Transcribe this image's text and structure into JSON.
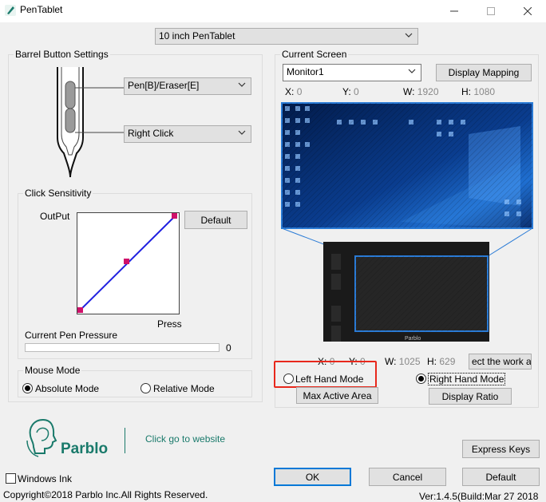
{
  "window": {
    "title": "PenTablet",
    "min_icon": "minimize-icon",
    "max_icon": "maximize-icon",
    "close_icon": "close-icon"
  },
  "device_select": {
    "value": "10 inch PenTablet"
  },
  "barrel": {
    "group_label": "Barrel Button Settings",
    "upper_button": "Pen[B]/Eraser[E]",
    "lower_button": "Right Click"
  },
  "sensitivity": {
    "group_label": "Click Sensitivity",
    "output_label": "OutPut",
    "press_label": "Press",
    "default_button": "Default",
    "pressure_label": "Current Pen Pressure",
    "pressure_value": "0",
    "pressure_level": 0
  },
  "mouse_mode": {
    "group_label": "Mouse Mode",
    "absolute": "Absolute Mode",
    "relative": "Relative Mode",
    "selected": "absolute"
  },
  "screen": {
    "group_label": "Current Screen",
    "monitor": "Monitor1",
    "display_mapping": "Display Mapping",
    "x_label": "X:",
    "x_value": "0",
    "y_label": "Y:",
    "y_value": "0",
    "w_label": "W:",
    "w_value": "1920",
    "h_label": "H:",
    "h_value": "1080"
  },
  "tablet_area": {
    "x_label": "X:",
    "x_value": "0",
    "y_label": "Y:",
    "y_value": "0",
    "w_label": "W:",
    "w_value": "1025",
    "h_label": "H:",
    "h_value": "629",
    "select_work_area": "ect the work a",
    "brand_text": "Parblo",
    "left_hand": "Left Hand Mode",
    "right_hand": "Right Hand Mode",
    "hand_selected": "right",
    "max_active_area": "Max Active Area",
    "display_ratio": "Display Ratio"
  },
  "footer": {
    "brand": "Parblo",
    "website_link": "Click go to website",
    "express_keys": "Express Keys",
    "windows_ink": "Windows Ink",
    "ok": "OK",
    "cancel": "Cancel",
    "default": "Default",
    "copyright": "Copyright©2018  Parblo Inc.All Rights Reserved.",
    "version": "Ver:1.4.5(Build:Mar 27 2018"
  },
  "colors": {
    "accent": "#0078d7",
    "highlight_red": "#e8281c",
    "brand_green": "#1a7a6b",
    "curve_blue": "#2020e0",
    "curve_point": "#d0106a"
  }
}
